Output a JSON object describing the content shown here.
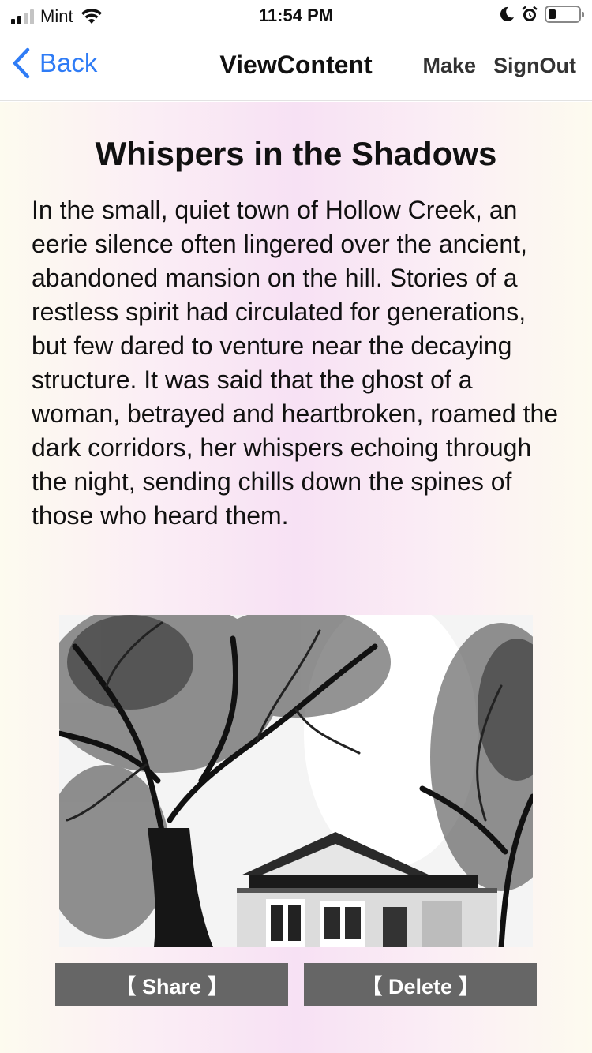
{
  "status_bar": {
    "carrier": "Mint",
    "time": "11:54 PM",
    "signal_bars_filled": 2,
    "signal_bars_total": 4,
    "battery_level": 0.25,
    "icons": [
      "signal-icon",
      "wifi-icon",
      "moon-icon",
      "alarm-icon",
      "battery-icon"
    ]
  },
  "nav": {
    "back_label": "Back",
    "title": "ViewContent",
    "make_label": "Make",
    "signout_label": "SignOut"
  },
  "story": {
    "title": "Whispers in the Shadows",
    "body": "In the small, quiet town of Hollow Creek, an eerie silence often lingered over the ancient, abandoned mansion on the hill. Stories of a restless spirit had circulated for generations, but few dared to venture near the decaying structure. It was said that the ghost of a woman, betrayed and heartbroken, roamed the dark corridors, her whispers echoing through the night, sending chills down the spines of those who heard them.",
    "image_description_icon": "story-illustration"
  },
  "actions": {
    "share_label": "【 Share 】",
    "delete_label": "【 Delete 】"
  },
  "colors": {
    "accent": "#2f7cf6",
    "button_bg": "#666666",
    "button_text": "#ffffff",
    "gradient_edge": "#fdfbef",
    "gradient_center": "#f7e1f4"
  }
}
